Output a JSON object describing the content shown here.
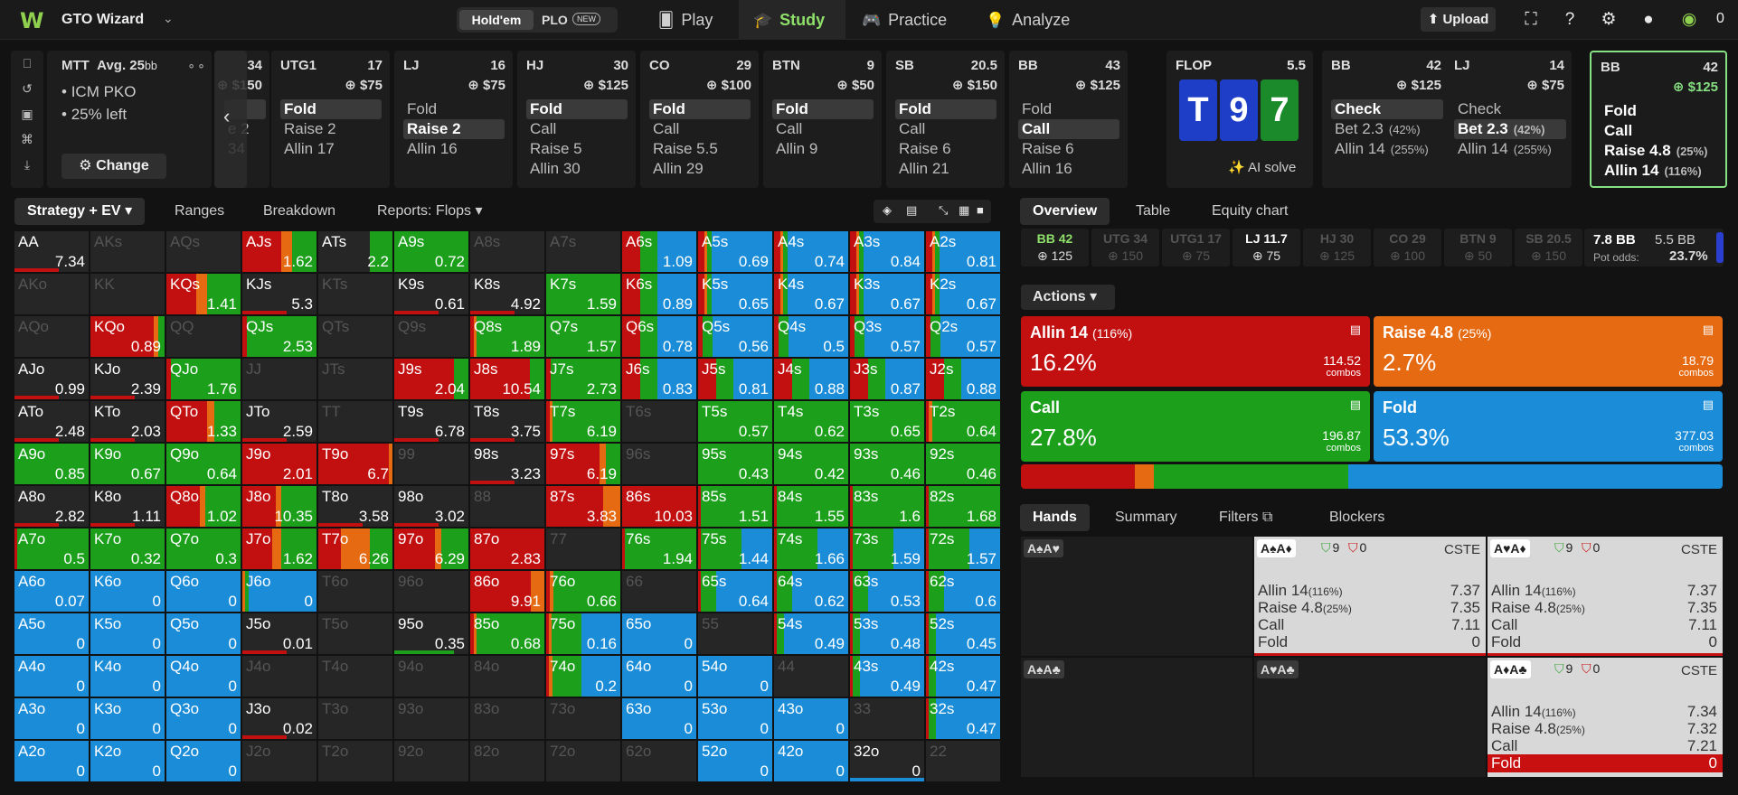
{
  "app": {
    "name": "GTO Wizard",
    "logo": "W"
  },
  "game_toggle": {
    "holdem": "Hold'em",
    "plo": "PLO",
    "plo_badge": "NEW"
  },
  "nav": [
    {
      "label": "Play",
      "icon": "cards-icon"
    },
    {
      "label": "Study",
      "icon": "study-icon"
    },
    {
      "label": "Practice",
      "icon": "gamepad-icon"
    },
    {
      "label": "Analyze",
      "icon": "bulb-icon"
    }
  ],
  "top_right": {
    "upload": "Upload",
    "credits": "0"
  },
  "mtt": {
    "title": "MTT",
    "avg": "Avg. 25",
    "avg_unit": "bb",
    "line1": "ICM PKO",
    "line2": "25% left",
    "change": "Change"
  },
  "nodes": [
    {
      "pos": "",
      "stack": "34",
      "chip": "$150",
      "opts": [
        {
          "t": "",
          "sel": true
        },
        {
          "t": "e 2"
        },
        {
          "t": "34"
        }
      ]
    },
    {
      "pos": "UTG1",
      "stack": "17",
      "chip": "$75",
      "opts": [
        {
          "t": "Fold",
          "sel": true
        },
        {
          "t": "Raise 2"
        },
        {
          "t": "Allin 17"
        }
      ]
    },
    {
      "pos": "LJ",
      "stack": "16",
      "chip": "$75",
      "opts": [
        {
          "t": "Fold"
        },
        {
          "t": "Raise 2",
          "sel": true
        },
        {
          "t": "Allin 16"
        }
      ]
    },
    {
      "pos": "HJ",
      "stack": "30",
      "chip": "$125",
      "opts": [
        {
          "t": "Fold",
          "sel": true
        },
        {
          "t": "Call"
        },
        {
          "t": "Raise 5"
        },
        {
          "t": "Allin 30"
        }
      ]
    },
    {
      "pos": "CO",
      "stack": "29",
      "chip": "$100",
      "opts": [
        {
          "t": "Fold",
          "sel": true
        },
        {
          "t": "Call"
        },
        {
          "t": "Raise 5.5"
        },
        {
          "t": "Allin 29"
        }
      ]
    },
    {
      "pos": "BTN",
      "stack": "9",
      "chip": "$50",
      "opts": [
        {
          "t": "Fold",
          "sel": true
        },
        {
          "t": "Call"
        },
        {
          "t": "Allin 9"
        }
      ]
    },
    {
      "pos": "SB",
      "stack": "20.5",
      "chip": "$150",
      "opts": [
        {
          "t": "Fold",
          "sel": true
        },
        {
          "t": "Call"
        },
        {
          "t": "Raise 6"
        },
        {
          "t": "Allin 21"
        }
      ]
    },
    {
      "pos": "BB",
      "stack": "43",
      "chip": "$125",
      "opts": [
        {
          "t": "Fold"
        },
        {
          "t": "Call",
          "sel": true
        },
        {
          "t": "Raise 6"
        },
        {
          "t": "Allin 16"
        }
      ]
    }
  ],
  "flop": {
    "label": "FLOP",
    "pot": "5.5",
    "cards": [
      "T",
      "9",
      "7"
    ],
    "ai": "AI solve"
  },
  "postflop": [
    {
      "pos": "BB",
      "stack": "42",
      "chip": "$125",
      "opts": [
        {
          "t": "Check",
          "sel": true
        },
        {
          "t": "Bet 2.3",
          "p": "(42%)"
        },
        {
          "t": "Allin 14",
          "p": "(255%)"
        }
      ]
    },
    {
      "pos": "LJ",
      "stack": "14",
      "chip": "$75",
      "opts": [
        {
          "t": "Check"
        },
        {
          "t": "Bet 2.3",
          "p": "(42%)",
          "sel": true
        },
        {
          "t": "Allin 14",
          "p": "(255%)"
        }
      ]
    },
    {
      "pos": "BB",
      "stack": "42",
      "chip": "$125",
      "opts": [
        {
          "t": "Fold"
        },
        {
          "t": "Call"
        },
        {
          "t": "Raise 4.8",
          "p": "(25%)"
        },
        {
          "t": "Allin 14",
          "p": "(116%)"
        }
      ]
    }
  ],
  "left_tabs": {
    "strategy": "Strategy + EV",
    "ranges": "Ranges",
    "breakdown": "Breakdown",
    "reports": "Reports: Flops"
  },
  "colors": {
    "allin": "#c21010",
    "raise": "#e56a12",
    "call": "#1ca01c",
    "fold": "#1a8cd8",
    "dead": "#262626"
  },
  "grid": [
    [
      [
        "AA",
        "7.34",
        "d"
      ],
      [
        "AKs",
        "",
        "x"
      ],
      [
        "AQs",
        "",
        "x"
      ],
      [
        "AJs",
        "1.62",
        "r3"
      ],
      [
        "ATs",
        "2.2",
        "c1"
      ],
      [
        "A9s",
        "0.72",
        "c"
      ],
      [
        "A8s",
        "",
        "x"
      ],
      [
        "A7s",
        "",
        "x"
      ],
      [
        "A6s",
        "1.09",
        "f2"
      ],
      [
        "A5s",
        "0.69",
        "f1"
      ],
      [
        "A4s",
        "0.74",
        "f1"
      ],
      [
        "A3s",
        "0.84",
        "f1"
      ],
      [
        "A2s",
        "0.81",
        "f1"
      ]
    ],
    [
      [
        "AKo",
        "",
        "x"
      ],
      [
        "KK",
        "",
        "x"
      ],
      [
        "KQs",
        "1.41",
        "r2"
      ],
      [
        "KJs",
        "5.3",
        "d"
      ],
      [
        "KTs",
        "",
        "x"
      ],
      [
        "K9s",
        "0.61",
        "d"
      ],
      [
        "K8s",
        "4.92",
        "d"
      ],
      [
        "K7s",
        "1.59",
        "c"
      ],
      [
        "K6s",
        "0.89",
        "f2"
      ],
      [
        "K5s",
        "0.65",
        "f1"
      ],
      [
        "K4s",
        "0.67",
        "f1"
      ],
      [
        "K3s",
        "0.67",
        "f1"
      ],
      [
        "K2s",
        "0.67",
        "f1"
      ]
    ],
    [
      [
        "AQo",
        "",
        "x"
      ],
      [
        "KQo",
        "0.89",
        "r4"
      ],
      [
        "QQ",
        "",
        "x"
      ],
      [
        "QJs",
        "2.53",
        "c2"
      ],
      [
        "QTs",
        "",
        "x"
      ],
      [
        "Q9s",
        "",
        "x"
      ],
      [
        "Q8s",
        "1.89",
        "c3"
      ],
      [
        "Q7s",
        "1.57",
        "c"
      ],
      [
        "Q6s",
        "0.78",
        "f2"
      ],
      [
        "Q5s",
        "0.56",
        "f3"
      ],
      [
        "Q4s",
        "0.5",
        "f3"
      ],
      [
        "Q3s",
        "0.57",
        "f3"
      ],
      [
        "Q2s",
        "0.57",
        "f3"
      ]
    ],
    [
      [
        "AJo",
        "0.99",
        "d"
      ],
      [
        "KJo",
        "2.39",
        "d"
      ],
      [
        "QJo",
        "1.76",
        "c2"
      ],
      [
        "JJ",
        "",
        "x"
      ],
      [
        "JTs",
        "",
        "x"
      ],
      [
        "J9s",
        "2.04",
        "r1"
      ],
      [
        "J8s",
        "10.54",
        "r1"
      ],
      [
        "J7s",
        "2.73",
        "c2"
      ],
      [
        "J6s",
        "0.83",
        "f2"
      ],
      [
        "J5s",
        "0.81",
        "f2"
      ],
      [
        "J4s",
        "0.88",
        "f2"
      ],
      [
        "J3s",
        "0.87",
        "f2"
      ],
      [
        "J2s",
        "0.88",
        "f2"
      ]
    ],
    [
      [
        "ATo",
        "2.48",
        "d"
      ],
      [
        "KTo",
        "2.03",
        "d"
      ],
      [
        "QTo",
        "1.33",
        "r5"
      ],
      [
        "JTo",
        "2.59",
        "d"
      ],
      [
        "TT",
        "",
        "x"
      ],
      [
        "T9s",
        "6.78",
        "d"
      ],
      [
        "T8s",
        "3.75",
        "d"
      ],
      [
        "T7s",
        "6.19",
        "c3"
      ],
      [
        "T6s",
        "",
        "x"
      ],
      [
        "T5s",
        "0.57",
        "c"
      ],
      [
        "T4s",
        "0.62",
        "c"
      ],
      [
        "T3s",
        "0.65",
        "c"
      ],
      [
        "T2s",
        "0.64",
        "c4"
      ]
    ],
    [
      [
        "A9o",
        "0.85",
        "c"
      ],
      [
        "K9o",
        "0.67",
        "c"
      ],
      [
        "Q9o",
        "0.64",
        "c"
      ],
      [
        "J9o",
        "2.01",
        "r6"
      ],
      [
        "T9o",
        "6.7",
        "r7"
      ],
      [
        "99",
        "",
        "x"
      ],
      [
        "98s",
        "3.23",
        "d"
      ],
      [
        "97s",
        "6.19",
        "r8"
      ],
      [
        "96s",
        "",
        "x"
      ],
      [
        "95s",
        "0.43",
        "c"
      ],
      [
        "94s",
        "0.42",
        "c"
      ],
      [
        "93s",
        "0.46",
        "c"
      ],
      [
        "92s",
        "0.46",
        "c"
      ]
    ],
    [
      [
        "A8o",
        "2.82",
        "d"
      ],
      [
        "K8o",
        "1.11",
        "d"
      ],
      [
        "Q8o",
        "1.02",
        "r9"
      ],
      [
        "J8o",
        "10.35",
        "r9"
      ],
      [
        "T8o",
        "3.58",
        "d"
      ],
      [
        "98o",
        "3.02",
        "d"
      ],
      [
        "88",
        "",
        "x"
      ],
      [
        "87s",
        "3.83",
        "r10"
      ],
      [
        "86s",
        "10.03",
        "r11"
      ],
      [
        "85s",
        "1.51",
        "c5"
      ],
      [
        "84s",
        "1.55",
        "c5"
      ],
      [
        "83s",
        "1.6",
        "c5"
      ],
      [
        "82s",
        "1.68",
        "c5"
      ]
    ],
    [
      [
        "A7o",
        "0.5",
        "c6"
      ],
      [
        "K7o",
        "0.32",
        "c"
      ],
      [
        "Q7o",
        "0.3",
        "c"
      ],
      [
        "J7o",
        "1.62",
        "r12"
      ],
      [
        "T7o",
        "6.26",
        "r13"
      ],
      [
        "97o",
        "6.29",
        "r14"
      ],
      [
        "87o",
        "2.83",
        "r15"
      ],
      [
        "77",
        "",
        "x"
      ],
      [
        "76s",
        "1.94",
        "c7"
      ],
      [
        "75s",
        "1.44",
        "c8"
      ],
      [
        "74s",
        "1.66",
        "c8"
      ],
      [
        "73s",
        "1.59",
        "c8"
      ],
      [
        "72s",
        "1.57",
        "c8"
      ]
    ],
    [
      [
        "A6o",
        "0.07",
        "f"
      ],
      [
        "K6o",
        "0",
        "f"
      ],
      [
        "Q6o",
        "0",
        "f"
      ],
      [
        "J6o",
        "0",
        "f4"
      ],
      [
        "T6o",
        "",
        "x"
      ],
      [
        "96o",
        "",
        "x"
      ],
      [
        "86o",
        "9.91",
        "r16"
      ],
      [
        "76o",
        "0.66",
        "c9"
      ],
      [
        "66",
        "",
        "x"
      ],
      [
        "65s",
        "0.64",
        "c10"
      ],
      [
        "64s",
        "0.62",
        "c10"
      ],
      [
        "63s",
        "0.53",
        "c10"
      ],
      [
        "62s",
        "0.6",
        "c10"
      ]
    ],
    [
      [
        "A5o",
        "0",
        "f"
      ],
      [
        "K5o",
        "0",
        "f"
      ],
      [
        "Q5o",
        "0",
        "f"
      ],
      [
        "J5o",
        "0.01",
        "d"
      ],
      [
        "T5o",
        "",
        "x"
      ],
      [
        "95o",
        "0.35",
        "c11"
      ],
      [
        "85o",
        "0.68",
        "c12"
      ],
      [
        "75o",
        "0.16",
        "c13"
      ],
      [
        "65o",
        "0",
        "f"
      ],
      [
        "55",
        "",
        "x"
      ],
      [
        "54s",
        "0.49",
        "c14"
      ],
      [
        "53s",
        "0.48",
        "c14"
      ],
      [
        "52s",
        "0.45",
        "c14"
      ]
    ],
    [
      [
        "A4o",
        "0",
        "f"
      ],
      [
        "K4o",
        "0",
        "f"
      ],
      [
        "Q4o",
        "0",
        "f"
      ],
      [
        "J4o",
        "",
        "x"
      ],
      [
        "T4o",
        "",
        "x"
      ],
      [
        "94o",
        "",
        "x"
      ],
      [
        "84o",
        "",
        "x"
      ],
      [
        "74o",
        "0.2",
        "c15"
      ],
      [
        "64o",
        "0",
        "f"
      ],
      [
        "54o",
        "0",
        "f"
      ],
      [
        "44",
        "",
        "x"
      ],
      [
        "43s",
        "0.49",
        "c14"
      ],
      [
        "42s",
        "0.47",
        "c14"
      ]
    ],
    [
      [
        "A3o",
        "0",
        "f"
      ],
      [
        "K3o",
        "0",
        "f"
      ],
      [
        "Q3o",
        "0",
        "f"
      ],
      [
        "J3o",
        "0.02",
        "d"
      ],
      [
        "T3o",
        "",
        "x"
      ],
      [
        "93o",
        "",
        "x"
      ],
      [
        "83o",
        "",
        "x"
      ],
      [
        "73o",
        "",
        "x"
      ],
      [
        "63o",
        "0",
        "f"
      ],
      [
        "53o",
        "0",
        "f"
      ],
      [
        "43o",
        "0",
        "f"
      ],
      [
        "33",
        "",
        "x"
      ],
      [
        "32s",
        "0.47",
        "c14"
      ]
    ],
    [
      [
        "A2o",
        "0",
        "f"
      ],
      [
        "K2o",
        "0",
        "f"
      ],
      [
        "Q2o",
        "0",
        "f"
      ],
      [
        "J2o",
        "",
        "x"
      ],
      [
        "T2o",
        "",
        "x"
      ],
      [
        "92o",
        "",
        "x"
      ],
      [
        "82o",
        "",
        "x"
      ],
      [
        "72o",
        "",
        "x"
      ],
      [
        "62o",
        "",
        "x"
      ],
      [
        "52o",
        "0",
        "f"
      ],
      [
        "42o",
        "0",
        "f"
      ],
      [
        "32o",
        "0",
        "f5"
      ],
      [
        "22",
        "",
        "x"
      ]
    ]
  ],
  "right_tabs": {
    "overview": "Overview",
    "table": "Table",
    "equity": "Equity chart"
  },
  "slots": [
    {
      "t": "BB 42",
      "b": "125",
      "active": true
    },
    {
      "t": "UTG 34",
      "b": "150"
    },
    {
      "t": "UTG1 17",
      "b": "75"
    },
    {
      "t": "LJ 11.7",
      "b": "75",
      "active": true
    },
    {
      "t": "HJ 30",
      "b": "125"
    },
    {
      "t": "CO 29",
      "b": "100"
    },
    {
      "t": "BTN 9",
      "b": "50"
    },
    {
      "t": "SB 20.5",
      "b": "150"
    }
  ],
  "pot": {
    "bb": "7.8 BB",
    "bb2": "5.5 BB",
    "odds_label": "Pot odds:",
    "odds": "23.7%"
  },
  "actions_label": "Actions",
  "actions": [
    {
      "label": "Allin 14",
      "sub": "(116%)",
      "pct": "16.2%",
      "combos": "114.52",
      "color": "#c21010"
    },
    {
      "label": "Raise 4.8",
      "sub": "(25%)",
      "pct": "2.7%",
      "combos": "18.79",
      "color": "#e56a12"
    },
    {
      "label": "Call",
      "sub": "",
      "pct": "27.8%",
      "combos": "196.87",
      "color": "#1ca01c"
    },
    {
      "label": "Fold",
      "sub": "",
      "pct": "53.3%",
      "combos": "377.03",
      "color": "#1a8cd8"
    }
  ],
  "combos_word": "combos",
  "freq_bar": [
    16.2,
    2.7,
    27.8,
    53.3
  ],
  "hand_tabs": {
    "hands": "Hands",
    "summary": "Summary",
    "filters": "Filters",
    "blockers": "Blockers"
  },
  "hands": [
    {
      "tag": "A♠A♥",
      "lit": false
    },
    {
      "tag": "A♠A♦",
      "lit": true,
      "shield": "9",
      "heart": "0",
      "cste": "CSTE",
      "rows": [
        [
          "Allin 14",
          "(116%)",
          "7.37"
        ],
        [
          "Raise 4.8",
          "(25%)",
          "7.35"
        ],
        [
          "Call",
          "",
          "7.11"
        ],
        [
          "Fold",
          "",
          "0"
        ]
      ]
    },
    {
      "tag": "A♥A♦",
      "lit": true,
      "shield": "9",
      "heart": "0",
      "cste": "CSTE",
      "rows": [
        [
          "Allin 14",
          "(116%)",
          "7.37"
        ],
        [
          "Raise 4.8",
          "(25%)",
          "7.35"
        ],
        [
          "Call",
          "",
          "7.11"
        ],
        [
          "Fold",
          "",
          "0"
        ]
      ]
    },
    {
      "tag": "A♠A♣",
      "lit": false
    },
    {
      "tag": "A♥A♣",
      "lit": false
    },
    {
      "tag": "A♦A♣",
      "lit": true,
      "shield": "9",
      "heart": "0",
      "cste": "CSTE",
      "rows": [
        [
          "Allin 14",
          "(116%)",
          "7.34"
        ],
        [
          "Raise 4.8",
          "(25%)",
          "7.32"
        ],
        [
          "Call",
          "",
          "7.21"
        ],
        [
          "Fold",
          "",
          "0"
        ]
      ]
    }
  ]
}
